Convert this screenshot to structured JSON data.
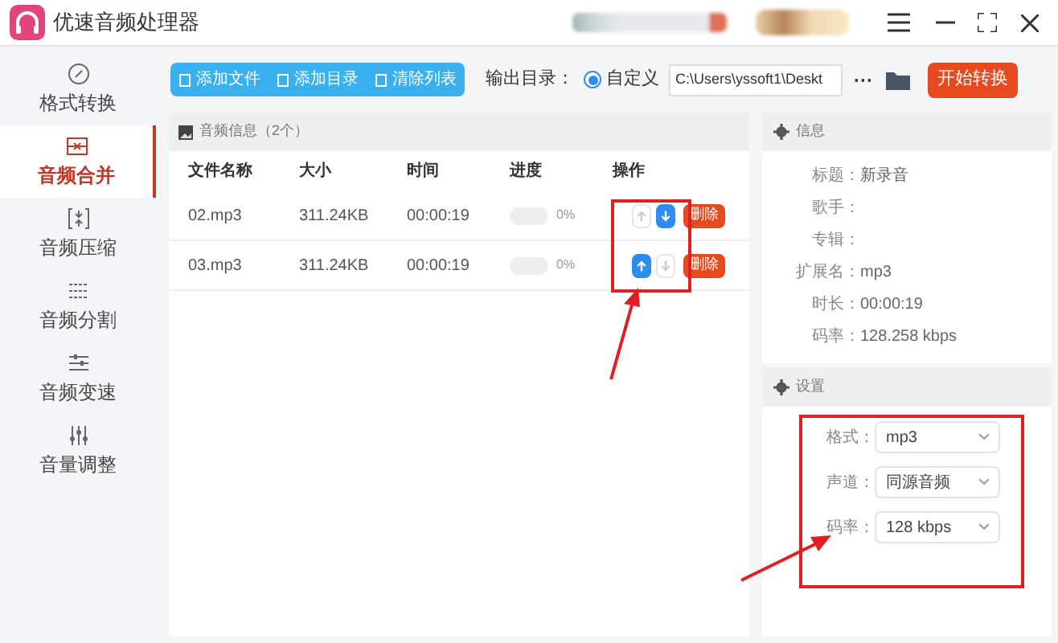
{
  "window": {
    "title": "优速音频处理器"
  },
  "toolbar": {
    "buttons": [
      "添加文件",
      "添加目录",
      "清除列表"
    ],
    "output_label": "输出目录：",
    "output_option": {
      "label": "自定义",
      "selected": true
    },
    "output_path": "C:\\Users\\yssoft1\\Deskt",
    "more": "···",
    "start_button": "开始转换"
  },
  "sidebar": {
    "items": [
      {
        "label": "格式转换",
        "selected": false
      },
      {
        "label": "音频合并",
        "selected": true
      },
      {
        "label": "音频压缩",
        "selected": false
      },
      {
        "label": "音频分割",
        "selected": false
      },
      {
        "label": "音频变速",
        "selected": false
      },
      {
        "label": "音量调整",
        "selected": false
      }
    ]
  },
  "file_list": {
    "title": "音频信息（2个）",
    "columns": [
      "文件名称",
      "大小",
      "时间",
      "进度",
      "操作"
    ],
    "rows": [
      {
        "name": "02.mp3",
        "size": "311.24KB",
        "time": "00:00:19",
        "level": 0,
        "progress": "0%",
        "up_disabled": true,
        "down_disabled": false,
        "delete": "删除"
      },
      {
        "name": "03.mp3",
        "size": "311.24KB",
        "time": "00:00:19",
        "level": 0,
        "progress": "0%",
        "up_disabled": false,
        "down_disabled": true,
        "delete": "删除"
      }
    ]
  },
  "info": {
    "title": "信息",
    "fields": [
      {
        "label": "标题：",
        "value": "新录音"
      },
      {
        "label": "歌手："
      },
      {
        "label": "专辑："
      },
      {
        "label": "扩展名：",
        "value": "mp3"
      },
      {
        "label": "时长：",
        "value": "00:00:19"
      },
      {
        "label": "码率：",
        "value": "128.258 kbps"
      }
    ]
  },
  "settings": {
    "title": "设置",
    "fields": [
      {
        "label": "格式：",
        "value": "mp3"
      },
      {
        "label": "声道：",
        "value": "同源音频"
      },
      {
        "label": "码率：",
        "value": "128 kbps"
      }
    ]
  }
}
